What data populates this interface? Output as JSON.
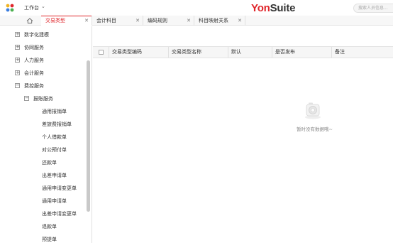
{
  "topbar": {
    "workbench_label": "工作台",
    "brand_yon": "Yon",
    "brand_suite": "Suite",
    "search_placeholder": "搜索人员信息..."
  },
  "tabs": [
    {
      "label": "交易类型",
      "active": true
    },
    {
      "label": "会计科目",
      "active": false
    },
    {
      "label": "编码规则",
      "active": false
    },
    {
      "label": "科目映射关系",
      "active": false
    }
  ],
  "sidebar": {
    "items": [
      {
        "label": "数字化建模",
        "toggle": "+"
      },
      {
        "label": "协同服务",
        "toggle": "+"
      },
      {
        "label": "人力服务",
        "toggle": "+"
      },
      {
        "label": "会计服务",
        "toggle": "+"
      },
      {
        "label": "费控服务",
        "toggle": "−"
      },
      {
        "label": "报账服务",
        "toggle": "−"
      },
      {
        "label": "通用报销单"
      },
      {
        "label": "差旅费报销单"
      },
      {
        "label": "个人借款单"
      },
      {
        "label": "对公预付单"
      },
      {
        "label": "还款单"
      },
      {
        "label": "出差申请单"
      },
      {
        "label": "通用申请变更单"
      },
      {
        "label": "通用申请单"
      },
      {
        "label": "出差申请变更单"
      },
      {
        "label": "退款单"
      },
      {
        "label": "预提单"
      }
    ]
  },
  "table": {
    "columns": [
      "交易类型编码",
      "交易类型名称",
      "默认",
      "是否发布",
      "备注"
    ]
  },
  "empty_state": {
    "text": "暂时没有数据哦~"
  },
  "colors": {
    "accent": "#e0262b",
    "logo_dots": [
      "#f0b323",
      "#e0262b",
      "#3b7de0",
      "#4cb050"
    ]
  }
}
